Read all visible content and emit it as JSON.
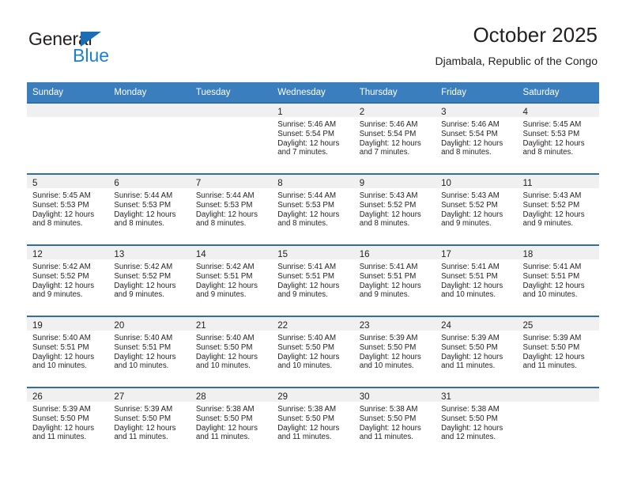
{
  "brand": {
    "name_part1": "General",
    "name_part2": "Blue",
    "accent_color": "#1b7fd4",
    "triangle_color": "#1b6eb5"
  },
  "header": {
    "title": "October 2025",
    "subtitle": "Djambala, Republic of the Congo"
  },
  "theme": {
    "header_row_bg": "#3a7ebe",
    "week_separator": "#2f6ea8",
    "daynum_band_bg": "#f0f0f0",
    "text_color": "#231f20"
  },
  "weekday_headers": [
    "Sunday",
    "Monday",
    "Tuesday",
    "Wednesday",
    "Thursday",
    "Friday",
    "Saturday"
  ],
  "labels": {
    "sunrise_prefix": "Sunrise:",
    "sunset_prefix": "Sunset:",
    "daylight_prefix": "Daylight:"
  },
  "weeks": [
    [
      {
        "day": "",
        "empty": true,
        "sunrise": "",
        "sunset": "",
        "daylight_line1": "",
        "daylight_line2": ""
      },
      {
        "day": "",
        "empty": true,
        "sunrise": "",
        "sunset": "",
        "daylight_line1": "",
        "daylight_line2": ""
      },
      {
        "day": "",
        "empty": true,
        "sunrise": "",
        "sunset": "",
        "daylight_line1": "",
        "daylight_line2": ""
      },
      {
        "day": "1",
        "empty": false,
        "sunrise": "Sunrise: 5:46 AM",
        "sunset": "Sunset: 5:54 PM",
        "daylight_line1": "Daylight: 12 hours",
        "daylight_line2": "and 7 minutes."
      },
      {
        "day": "2",
        "empty": false,
        "sunrise": "Sunrise: 5:46 AM",
        "sunset": "Sunset: 5:54 PM",
        "daylight_line1": "Daylight: 12 hours",
        "daylight_line2": "and 7 minutes."
      },
      {
        "day": "3",
        "empty": false,
        "sunrise": "Sunrise: 5:46 AM",
        "sunset": "Sunset: 5:54 PM",
        "daylight_line1": "Daylight: 12 hours",
        "daylight_line2": "and 8 minutes."
      },
      {
        "day": "4",
        "empty": false,
        "sunrise": "Sunrise: 5:45 AM",
        "sunset": "Sunset: 5:53 PM",
        "daylight_line1": "Daylight: 12 hours",
        "daylight_line2": "and 8 minutes."
      }
    ],
    [
      {
        "day": "5",
        "empty": false,
        "sunrise": "Sunrise: 5:45 AM",
        "sunset": "Sunset: 5:53 PM",
        "daylight_line1": "Daylight: 12 hours",
        "daylight_line2": "and 8 minutes."
      },
      {
        "day": "6",
        "empty": false,
        "sunrise": "Sunrise: 5:44 AM",
        "sunset": "Sunset: 5:53 PM",
        "daylight_line1": "Daylight: 12 hours",
        "daylight_line2": "and 8 minutes."
      },
      {
        "day": "7",
        "empty": false,
        "sunrise": "Sunrise: 5:44 AM",
        "sunset": "Sunset: 5:53 PM",
        "daylight_line1": "Daylight: 12 hours",
        "daylight_line2": "and 8 minutes."
      },
      {
        "day": "8",
        "empty": false,
        "sunrise": "Sunrise: 5:44 AM",
        "sunset": "Sunset: 5:53 PM",
        "daylight_line1": "Daylight: 12 hours",
        "daylight_line2": "and 8 minutes."
      },
      {
        "day": "9",
        "empty": false,
        "sunrise": "Sunrise: 5:43 AM",
        "sunset": "Sunset: 5:52 PM",
        "daylight_line1": "Daylight: 12 hours",
        "daylight_line2": "and 8 minutes."
      },
      {
        "day": "10",
        "empty": false,
        "sunrise": "Sunrise: 5:43 AM",
        "sunset": "Sunset: 5:52 PM",
        "daylight_line1": "Daylight: 12 hours",
        "daylight_line2": "and 9 minutes."
      },
      {
        "day": "11",
        "empty": false,
        "sunrise": "Sunrise: 5:43 AM",
        "sunset": "Sunset: 5:52 PM",
        "daylight_line1": "Daylight: 12 hours",
        "daylight_line2": "and 9 minutes."
      }
    ],
    [
      {
        "day": "12",
        "empty": false,
        "sunrise": "Sunrise: 5:42 AM",
        "sunset": "Sunset: 5:52 PM",
        "daylight_line1": "Daylight: 12 hours",
        "daylight_line2": "and 9 minutes."
      },
      {
        "day": "13",
        "empty": false,
        "sunrise": "Sunrise: 5:42 AM",
        "sunset": "Sunset: 5:52 PM",
        "daylight_line1": "Daylight: 12 hours",
        "daylight_line2": "and 9 minutes."
      },
      {
        "day": "14",
        "empty": false,
        "sunrise": "Sunrise: 5:42 AM",
        "sunset": "Sunset: 5:51 PM",
        "daylight_line1": "Daylight: 12 hours",
        "daylight_line2": "and 9 minutes."
      },
      {
        "day": "15",
        "empty": false,
        "sunrise": "Sunrise: 5:41 AM",
        "sunset": "Sunset: 5:51 PM",
        "daylight_line1": "Daylight: 12 hours",
        "daylight_line2": "and 9 minutes."
      },
      {
        "day": "16",
        "empty": false,
        "sunrise": "Sunrise: 5:41 AM",
        "sunset": "Sunset: 5:51 PM",
        "daylight_line1": "Daylight: 12 hours",
        "daylight_line2": "and 9 minutes."
      },
      {
        "day": "17",
        "empty": false,
        "sunrise": "Sunrise: 5:41 AM",
        "sunset": "Sunset: 5:51 PM",
        "daylight_line1": "Daylight: 12 hours",
        "daylight_line2": "and 10 minutes."
      },
      {
        "day": "18",
        "empty": false,
        "sunrise": "Sunrise: 5:41 AM",
        "sunset": "Sunset: 5:51 PM",
        "daylight_line1": "Daylight: 12 hours",
        "daylight_line2": "and 10 minutes."
      }
    ],
    [
      {
        "day": "19",
        "empty": false,
        "sunrise": "Sunrise: 5:40 AM",
        "sunset": "Sunset: 5:51 PM",
        "daylight_line1": "Daylight: 12 hours",
        "daylight_line2": "and 10 minutes."
      },
      {
        "day": "20",
        "empty": false,
        "sunrise": "Sunrise: 5:40 AM",
        "sunset": "Sunset: 5:51 PM",
        "daylight_line1": "Daylight: 12 hours",
        "daylight_line2": "and 10 minutes."
      },
      {
        "day": "21",
        "empty": false,
        "sunrise": "Sunrise: 5:40 AM",
        "sunset": "Sunset: 5:50 PM",
        "daylight_line1": "Daylight: 12 hours",
        "daylight_line2": "and 10 minutes."
      },
      {
        "day": "22",
        "empty": false,
        "sunrise": "Sunrise: 5:40 AM",
        "sunset": "Sunset: 5:50 PM",
        "daylight_line1": "Daylight: 12 hours",
        "daylight_line2": "and 10 minutes."
      },
      {
        "day": "23",
        "empty": false,
        "sunrise": "Sunrise: 5:39 AM",
        "sunset": "Sunset: 5:50 PM",
        "daylight_line1": "Daylight: 12 hours",
        "daylight_line2": "and 10 minutes."
      },
      {
        "day": "24",
        "empty": false,
        "sunrise": "Sunrise: 5:39 AM",
        "sunset": "Sunset: 5:50 PM",
        "daylight_line1": "Daylight: 12 hours",
        "daylight_line2": "and 11 minutes."
      },
      {
        "day": "25",
        "empty": false,
        "sunrise": "Sunrise: 5:39 AM",
        "sunset": "Sunset: 5:50 PM",
        "daylight_line1": "Daylight: 12 hours",
        "daylight_line2": "and 11 minutes."
      }
    ],
    [
      {
        "day": "26",
        "empty": false,
        "sunrise": "Sunrise: 5:39 AM",
        "sunset": "Sunset: 5:50 PM",
        "daylight_line1": "Daylight: 12 hours",
        "daylight_line2": "and 11 minutes."
      },
      {
        "day": "27",
        "empty": false,
        "sunrise": "Sunrise: 5:39 AM",
        "sunset": "Sunset: 5:50 PM",
        "daylight_line1": "Daylight: 12 hours",
        "daylight_line2": "and 11 minutes."
      },
      {
        "day": "28",
        "empty": false,
        "sunrise": "Sunrise: 5:38 AM",
        "sunset": "Sunset: 5:50 PM",
        "daylight_line1": "Daylight: 12 hours",
        "daylight_line2": "and 11 minutes."
      },
      {
        "day": "29",
        "empty": false,
        "sunrise": "Sunrise: 5:38 AM",
        "sunset": "Sunset: 5:50 PM",
        "daylight_line1": "Daylight: 12 hours",
        "daylight_line2": "and 11 minutes."
      },
      {
        "day": "30",
        "empty": false,
        "sunrise": "Sunrise: 5:38 AM",
        "sunset": "Sunset: 5:50 PM",
        "daylight_line1": "Daylight: 12 hours",
        "daylight_line2": "and 11 minutes."
      },
      {
        "day": "31",
        "empty": false,
        "sunrise": "Sunrise: 5:38 AM",
        "sunset": "Sunset: 5:50 PM",
        "daylight_line1": "Daylight: 12 hours",
        "daylight_line2": "and 12 minutes."
      },
      {
        "day": "",
        "empty": true,
        "sunrise": "",
        "sunset": "",
        "daylight_line1": "",
        "daylight_line2": ""
      }
    ]
  ]
}
